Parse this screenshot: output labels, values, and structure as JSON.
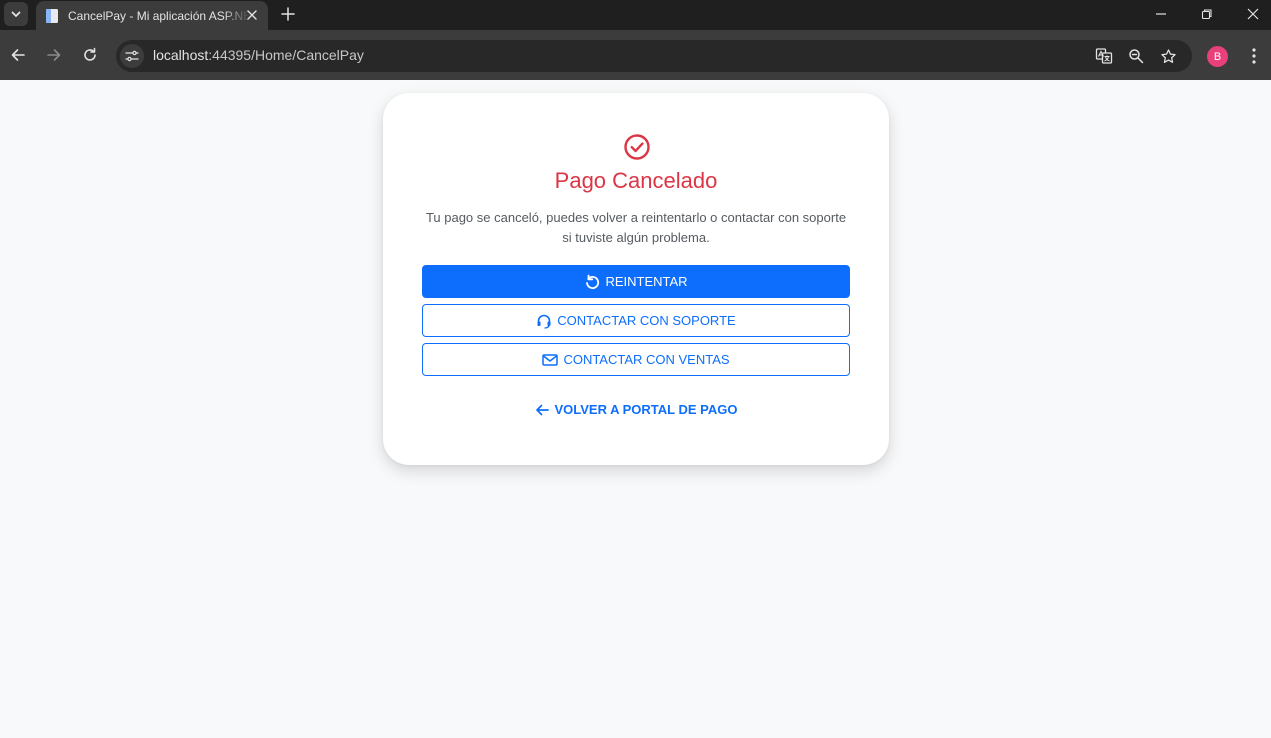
{
  "browser": {
    "tab_title": "CancelPay - Mi aplicación ASP.NET",
    "url_host": "localhost",
    "url_path": ":44395/Home/CancelPay",
    "avatar_letter": "B",
    "avatar_color": "#e8407a"
  },
  "page": {
    "title": "Pago Cancelado",
    "message": "Tu pago se canceló, puedes volver a reintentarlo o contactar con soporte si tuviste algún problema.",
    "retry_label": "REINTENTAR",
    "support_label": "CONTACTAR CON SOPORTE",
    "sales_label": "CONTACTAR CON VENTAS",
    "back_label": "VOLVER A PORTAL DE PAGO"
  },
  "icons": {
    "status": "check-circle-icon",
    "retry": "rotate-ccw-icon",
    "support": "headset-icon",
    "sales": "envelope-icon",
    "back": "arrow-left-icon"
  },
  "colors": {
    "accent": "#0d6efd",
    "danger": "#dc3545",
    "page_bg": "#f8f9fa"
  }
}
